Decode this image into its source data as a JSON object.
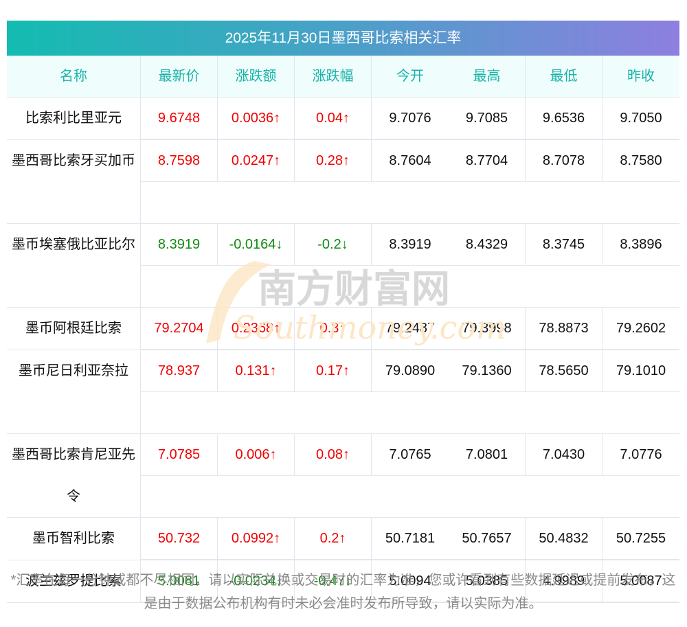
{
  "title": "2025年11月30日墨西哥比索相关汇率",
  "headers": [
    "名称",
    "最新价",
    "涨跌额",
    "涨跌幅",
    "今开",
    "最高",
    "最低",
    "昨收"
  ],
  "rows": [
    {
      "name": "比索利比里亚元",
      "dir": "up",
      "latest": "9.6748",
      "change": "0.0036↑",
      "pct": "0.04↑",
      "open": "9.7076",
      "high": "9.7085",
      "low": "9.6536",
      "prev": "9.7050"
    },
    {
      "name": "墨西哥比索牙买加币",
      "dir": "up",
      "latest": "8.7598",
      "change": "0.0247↑",
      "pct": "0.28↑",
      "open": "8.7604",
      "high": "8.7704",
      "low": "8.7078",
      "prev": "8.7580"
    },
    {
      "name": "墨币埃塞俄比亚比尔",
      "dir": "down",
      "latest": "8.3919",
      "change": "-0.0164↓",
      "pct": "-0.2↓",
      "open": "8.3919",
      "high": "8.4329",
      "low": "8.3745",
      "prev": "8.3896"
    },
    {
      "name": "墨币阿根廷比索",
      "dir": "up",
      "latest": "79.2704",
      "change": "0.2368↑",
      "pct": "0.3↑",
      "open": "79.2487",
      "high": "79.3998",
      "low": "78.8873",
      "prev": "79.2602"
    },
    {
      "name": "墨币尼日利亚奈拉",
      "dir": "up",
      "latest": "78.937",
      "change": "0.131↑",
      "pct": "0.17↑",
      "open": "79.0890",
      "high": "79.1360",
      "low": "78.5650",
      "prev": "79.1010"
    },
    {
      "name": "墨西哥比索肯尼亚先令",
      "dir": "up",
      "latest": "7.0785",
      "change": "0.006↑",
      "pct": "0.08↑",
      "open": "7.0765",
      "high": "7.0801",
      "low": "7.0430",
      "prev": "7.0776"
    },
    {
      "name": "墨币智利比索",
      "dir": "up",
      "latest": "50.732",
      "change": "0.0992↑",
      "pct": "0.2↑",
      "open": "50.7181",
      "high": "50.7657",
      "low": "50.4832",
      "prev": "50.7255"
    },
    {
      "name": "波兰兹罗提比索",
      "dir": "down",
      "latest": "5.0081",
      "change": "-0.0234↓",
      "pct": "-0.47↓",
      "open": "5.0094",
      "high": "5.0385",
      "low": "4.9989",
      "prev": "5.0087"
    }
  ],
  "watermark": {
    "cn": "南方财富网",
    "en": "Southmoney.com"
  },
  "footer": "*汇率在每一分钟或都不尽相同，请以实际兑换或交易时的汇率为准，您或许看到有些数据延迟或提前发布，这是由于数据公布机构有时未必会准时发布所导致，请以实际为准。",
  "colors": {
    "up": "#f20000",
    "down": "#0f8a0f",
    "header_text": "#18b3a8"
  }
}
